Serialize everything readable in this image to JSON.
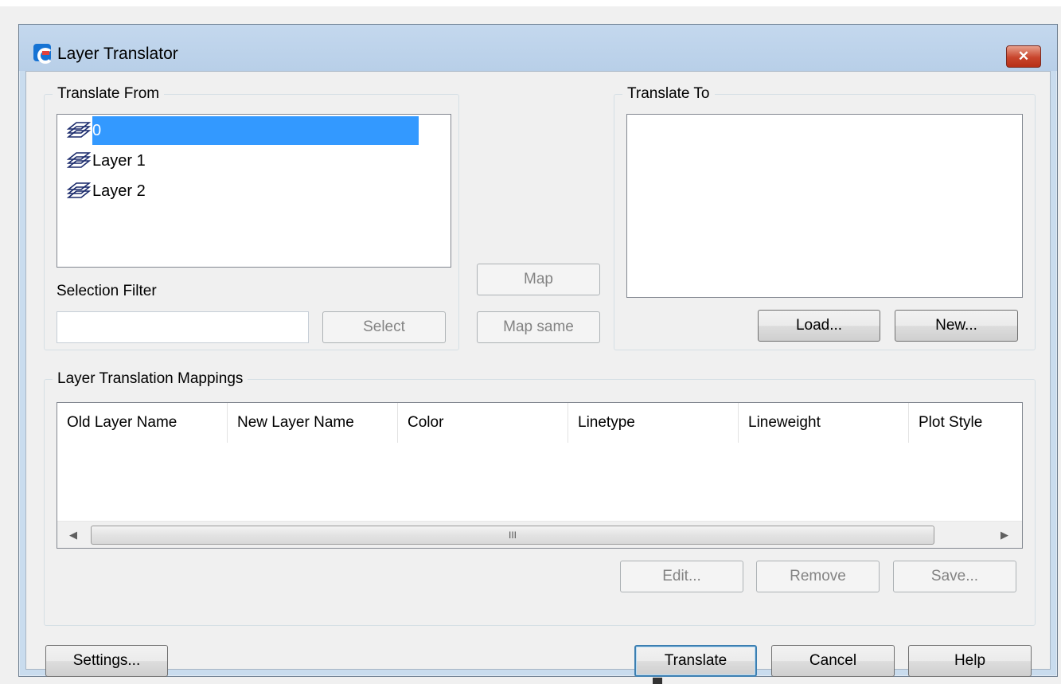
{
  "window": {
    "title": "Layer Translator",
    "close_glyph": "✕"
  },
  "translate_from": {
    "label": "Translate From",
    "layers": [
      {
        "name": "0",
        "selected": true
      },
      {
        "name": "Layer 1",
        "selected": false
      },
      {
        "name": "Layer 2",
        "selected": false
      }
    ],
    "selection_filter_label": "Selection Filter",
    "selection_filter_value": "",
    "select_button": "Select"
  },
  "middle": {
    "map_button": "Map",
    "map_same_button": "Map same"
  },
  "translate_to": {
    "label": "Translate To",
    "load_button": "Load...",
    "new_button": "New..."
  },
  "mappings": {
    "label": "Layer Translation Mappings",
    "columns": [
      "Old Layer Name",
      "New Layer Name",
      "Color",
      "Linetype",
      "Lineweight",
      "Plot Style"
    ],
    "rows": [],
    "scroll_thumb_glyph": "III",
    "edit_button": "Edit...",
    "remove_button": "Remove",
    "save_button": "Save..."
  },
  "footer": {
    "settings_button": "Settings...",
    "translate_button": "Translate",
    "cancel_button": "Cancel",
    "help_button": "Help"
  },
  "colors": {
    "selection": "#3399ff",
    "title_bar": "#c4d8ee",
    "close_button": "#c8452c"
  }
}
